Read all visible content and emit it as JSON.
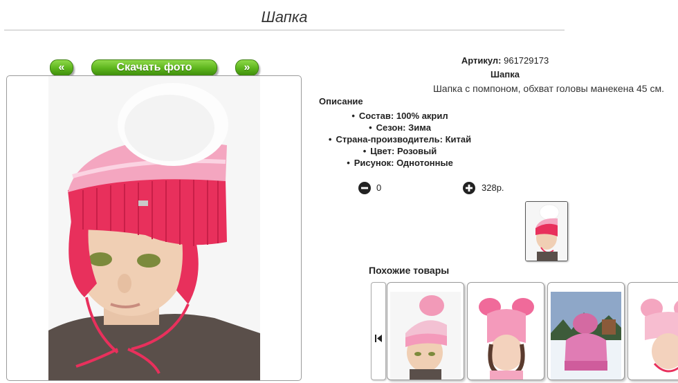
{
  "page": {
    "title": "Шапка"
  },
  "nav": {
    "prev_label": "«",
    "download_label": "Скачать фото",
    "next_label": "»"
  },
  "product": {
    "article_label": "Артикул:",
    "article_value": "961729173",
    "name": "Шапка",
    "short_description": "Шапка с помпоном, обхват головы манекена 45 см.",
    "description_heading": "Описание",
    "specs": [
      "Состав: 100% акрил",
      "Сезон: Зима",
      "Страна-производитель: Китай",
      "Цвет: Розовый",
      "Рисунок: Однотонные"
    ]
  },
  "cart": {
    "quantity": "0",
    "price": "328р."
  },
  "similar": {
    "title": "Похожие товары"
  },
  "colors": {
    "accent_green": "#5cb41c",
    "hat_pink": "#e8305c",
    "hat_light_pink": "#f4a6c0"
  },
  "icons": {
    "minus": "minus-circle-icon",
    "plus": "plus-circle-icon",
    "carousel_prev": "skip-prev-icon"
  }
}
